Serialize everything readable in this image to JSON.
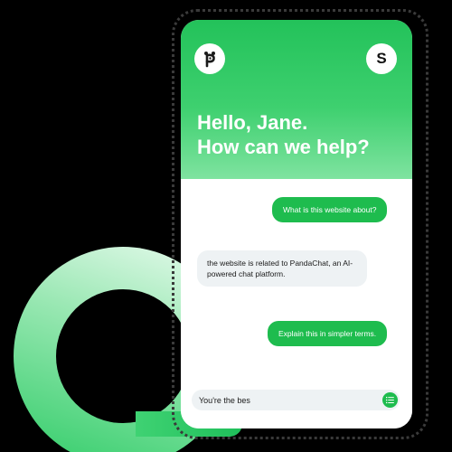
{
  "header": {
    "logo_letter": "p",
    "avatar_initial": "S",
    "greeting_line1": "Hello, Jane.",
    "greeting_line2": "How can we help?"
  },
  "messages": [
    {
      "role": "user",
      "text": "What is this website about?"
    },
    {
      "role": "bot",
      "text": "the website is related to PandaChat, an AI-powered chat platform."
    },
    {
      "role": "user",
      "text": "Explain this in simpler terms."
    }
  ],
  "composer": {
    "value": "You're the bes",
    "send_icon": "menu-lines-icon"
  },
  "colors": {
    "brand_green": "#1ebc4e",
    "hero_top": "#23c25a",
    "hero_bottom": "#7fe3a0",
    "bot_bubble": "#eef2f4"
  }
}
